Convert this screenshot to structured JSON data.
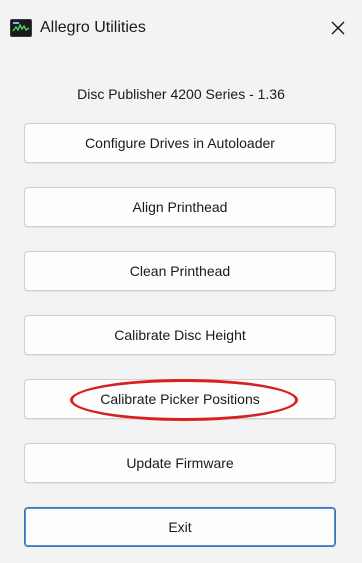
{
  "window": {
    "title": "Allegro Utilities",
    "close_icon": "close-icon",
    "app_icon": "allegro-app-icon"
  },
  "subtitle": "Disc Publisher 4200 Series - 1.36",
  "buttons": [
    {
      "label": "Configure Drives in Autoloader"
    },
    {
      "label": "Align Printhead"
    },
    {
      "label": "Clean Printhead"
    },
    {
      "label": "Calibrate Disc Height"
    },
    {
      "label": "Calibrate Picker Positions"
    },
    {
      "label": "Update Firmware"
    },
    {
      "label": "Exit"
    }
  ],
  "colors": {
    "highlight": "#d92020",
    "exit_border": "#3b73b8"
  }
}
